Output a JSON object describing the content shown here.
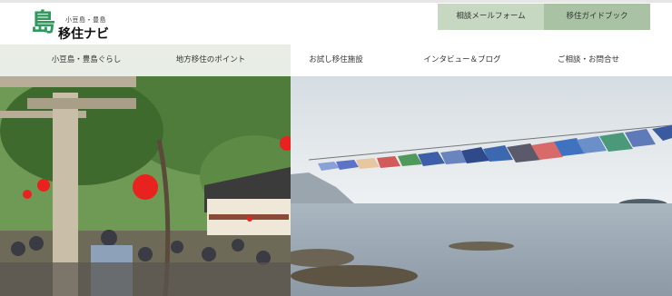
{
  "logo": {
    "mark": "島",
    "small_text": "小豆島・豊島",
    "main_text": "移住ナビ"
  },
  "header_buttons": {
    "consult": "相談メールフォーム",
    "guide": "移住ガイドブック"
  },
  "nav": [
    {
      "label": "小豆島・豊島ぐらし"
    },
    {
      "label": "地方移住のポイント"
    },
    {
      "label": "お試し移住施設"
    },
    {
      "label": "インタビュー＆ブログ"
    },
    {
      "label": "ご相談・お問合せ"
    }
  ],
  "colors": {
    "brand_green": "#2f9a5c",
    "consult_btn": "#c6d7c2",
    "guide_btn": "#a9c2a3"
  }
}
